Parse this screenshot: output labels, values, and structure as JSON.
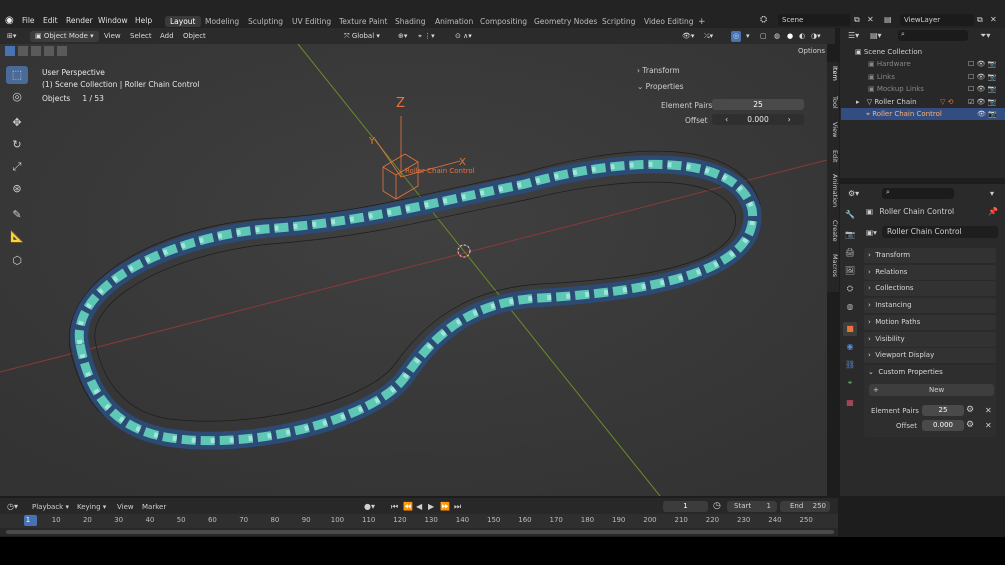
{
  "topbar": {
    "menus": [
      "File",
      "Edit",
      "Render",
      "Window",
      "Help"
    ],
    "workspaces": [
      "Layout",
      "Modeling",
      "Sculpting",
      "UV Editing",
      "Texture Paint",
      "Shading",
      "Animation",
      "Compositing",
      "Geometry Nodes",
      "Scripting",
      "Video Editing"
    ],
    "add_tab": "+",
    "scene": "Scene",
    "view_layer": "ViewLayer"
  },
  "viewport_header": {
    "mode": "Object Mode",
    "menus": [
      "View",
      "Select",
      "Add",
      "Object"
    ],
    "orientation": "Global",
    "options": "Options"
  },
  "viewport": {
    "perspective": "User Perspective",
    "collection_path": "(1) Scene Collection | Roller Chain Control",
    "objects_label": "Objects",
    "objects_count": "1 / 53",
    "axis_z": "Z",
    "axis_y": "Y",
    "axis_x": "X",
    "empty_label": "Roller Chain Control"
  },
  "npanel": {
    "tabs": [
      "Item",
      "Tool",
      "View",
      "Edit",
      "Animation",
      "Create",
      "Macros"
    ],
    "transform": "Transform",
    "properties": "Properties",
    "element_pairs_label": "Element Pairs",
    "element_pairs_value": "25",
    "offset_label": "Offset",
    "offset_value": "0.000"
  },
  "outliner": {
    "root": "Scene Collection",
    "items": [
      "Hardware",
      "Links",
      "Mockup Links",
      "Roller Chain",
      "Roller Chain Control"
    ]
  },
  "properties": {
    "object_name": "Roller Chain Control",
    "name_field": "Roller Chain Control",
    "panels": [
      "Transform",
      "Relations",
      "Collections",
      "Instancing",
      "Motion Paths",
      "Visibility",
      "Viewport Display",
      "Custom Properties"
    ],
    "new_button": "New",
    "custom": [
      {
        "label": "Element Pairs",
        "value": "25"
      },
      {
        "label": "Offset",
        "value": "0.000"
      }
    ]
  },
  "timeline": {
    "menus": [
      "Playback",
      "Keying",
      "View",
      "Marker"
    ],
    "current_frame": "1",
    "start_label": "Start",
    "start_value": "1",
    "end_label": "End",
    "end_value": "250",
    "ruler": [
      "1",
      "10",
      "20",
      "30",
      "40",
      "50",
      "60",
      "70",
      "80",
      "90",
      "100",
      "110",
      "120",
      "130",
      "140",
      "150",
      "160",
      "170",
      "180",
      "190",
      "200",
      "210",
      "220",
      "230",
      "240",
      "250"
    ]
  },
  "colors": {
    "accent": "#4772b3",
    "selected": "#e8743b",
    "chain": "#5fc7b6",
    "plate": "#2c4a73"
  }
}
